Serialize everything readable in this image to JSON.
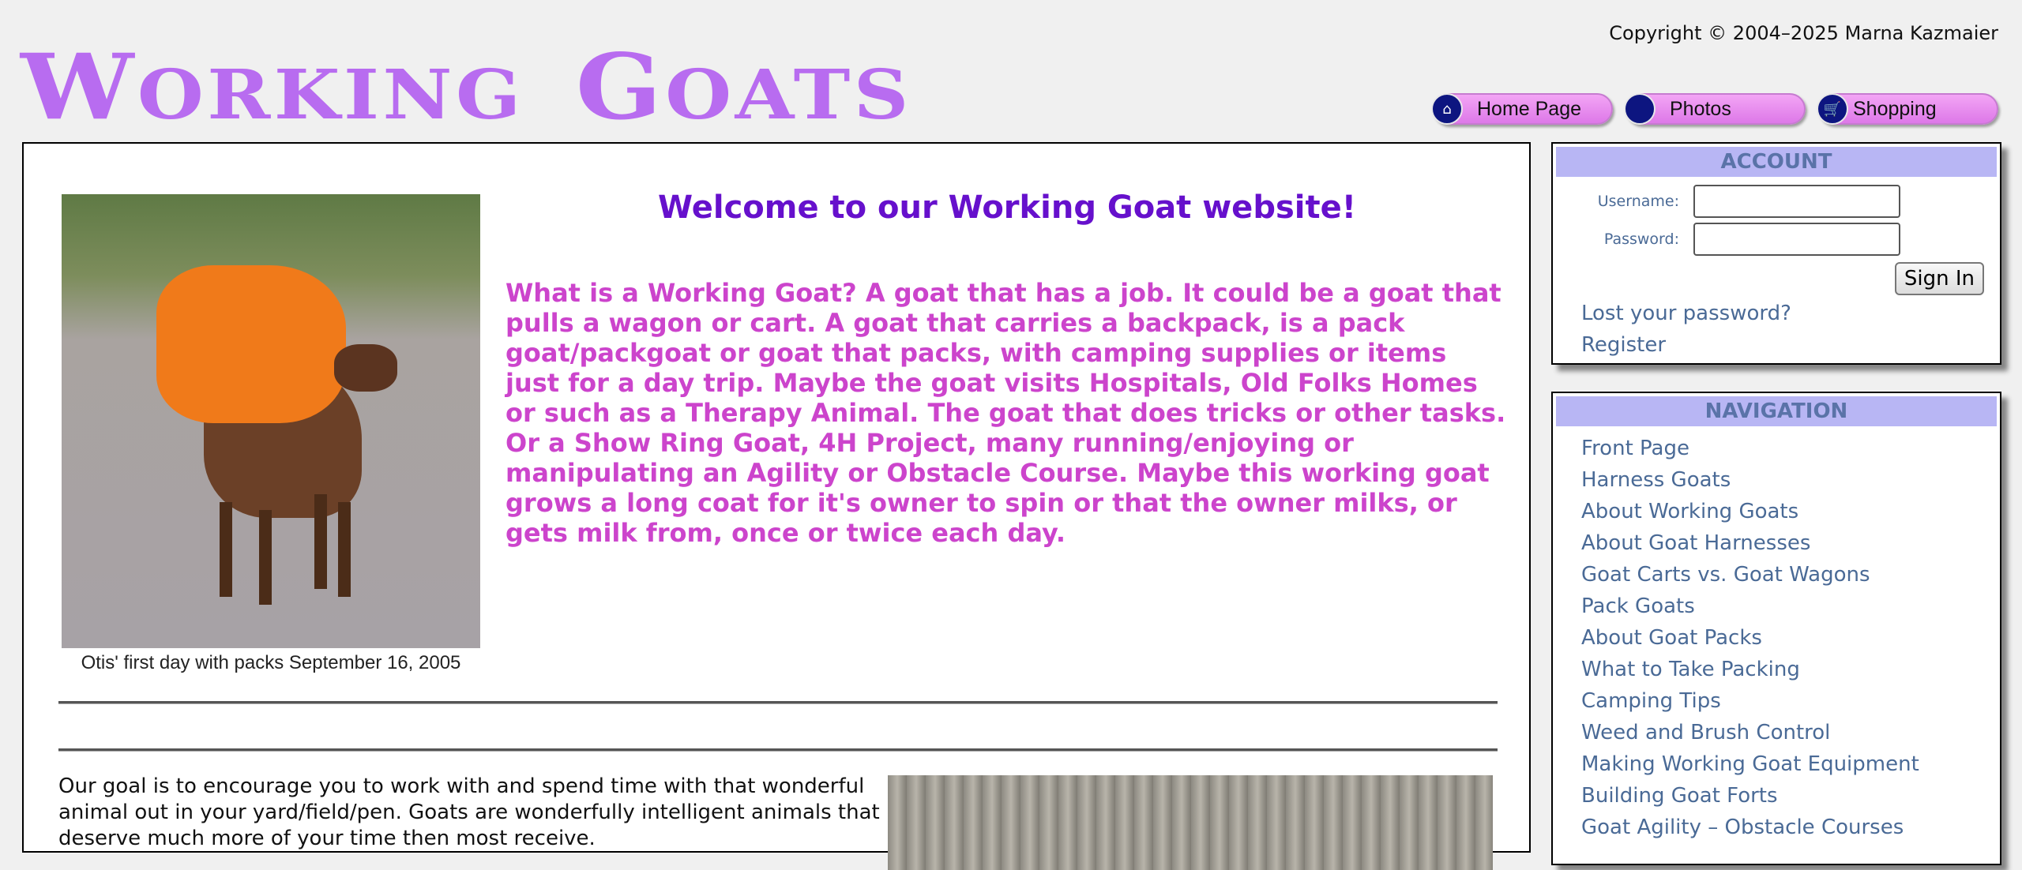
{
  "copyright": "Copyright © 2004–2025 Marna Kazmaier",
  "logo": {
    "word1_first": "W",
    "word1_rest": "ORKING",
    "word2_first": "G",
    "word2_rest": "OATS"
  },
  "topnav": [
    {
      "label": "Home Page",
      "icon": "home-icon"
    },
    {
      "label": "Photos",
      "icon": "photo-icon"
    },
    {
      "label": "Shopping",
      "icon": "cart-icon"
    }
  ],
  "main": {
    "photo_caption": "Otis' first day with packs  September 16, 2005",
    "welcome": "Welcome to our Working Goat website!",
    "intro": "What is a Working Goat? A goat that has a job. It could be a goat that pulls a wagon or cart. A goat that carries a backpack, is a pack goat/packgoat or goat that packs, with camping supplies or items just for a day trip. Maybe the goat visits Hospitals, Old Folks Homes or such as a Therapy Animal. The goat that does tricks or other tasks. Or a Show Ring Goat, 4H Project, many running/enjoying or manipulating an Agility or Obstacle Course. Maybe this working goat grows a long coat for it's owner to spin or that the owner milks, or gets milk from, once or twice each day.",
    "goal": "Our goal is to encourage you to work with and spend time with that wonderful animal out in your yard/field/pen. Goats are wonderfully intelligent animals that deserve much more of your time then most receive."
  },
  "account": {
    "title": "ACCOUNT",
    "username_label": "Username:",
    "password_label": "Password:",
    "signin_label": "Sign In",
    "lost_password": "Lost your password?",
    "register": "Register"
  },
  "navigation": {
    "title": "NAVIGATION",
    "items": [
      "Front Page",
      "Harness Goats",
      "About Working Goats",
      "About Goat Harnesses",
      "Goat Carts vs. Goat Wagons",
      "Pack Goats",
      "About Goat Packs",
      "What to Take Packing",
      "Camping Tips",
      "Weed and Brush Control",
      "Making Working Goat Equipment",
      "Building Goat Forts",
      "Goat Agility – Obstacle Courses"
    ]
  },
  "colors": {
    "background": "#f0f0f0",
    "logo": "#b86cf0",
    "welcome": "#6610cc",
    "intro": "#cc44cc",
    "panel_header": "#b8b6f4",
    "link": "#4a6a96",
    "nav_button": "#dd78e8",
    "nav_icon_circle": "#0d1580"
  }
}
